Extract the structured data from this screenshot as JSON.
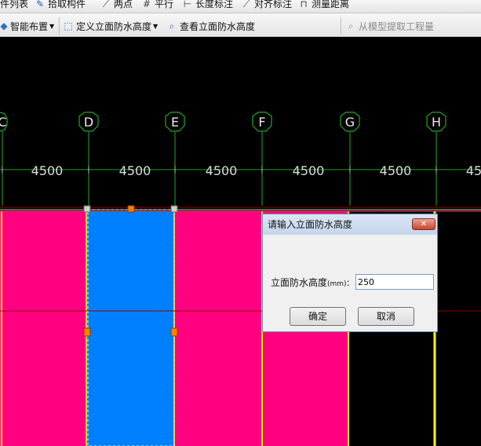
{
  "toolbar_top": {
    "items": [
      "件列表",
      "拾取构件",
      "两点",
      "平行",
      "长度标注",
      "对齐标注",
      "测量距离"
    ]
  },
  "toolbar_main": {
    "smart_layout": "智能布置",
    "define_height": "定义立面防水高度",
    "view_height": "查看立面防水高度",
    "extract": "从模型提取工程量"
  },
  "canvas": {
    "axes": [
      "C",
      "D",
      "E",
      "F",
      "G",
      "H"
    ],
    "dimensions": [
      "4500",
      "4500",
      "4500",
      "4500",
      "4500",
      "45"
    ],
    "colors": {
      "pink": "#ff0080",
      "blue": "#0080ff",
      "black": "#000000",
      "axis_green": "#22aa22",
      "yellow": "#ffff00"
    }
  },
  "dialog": {
    "title": "请输入立面防水高度",
    "close": "✕",
    "label": "立面防水高度",
    "unit": "(mm)",
    "colon": ":",
    "value": "250",
    "ok": "确定",
    "cancel": "取消"
  }
}
